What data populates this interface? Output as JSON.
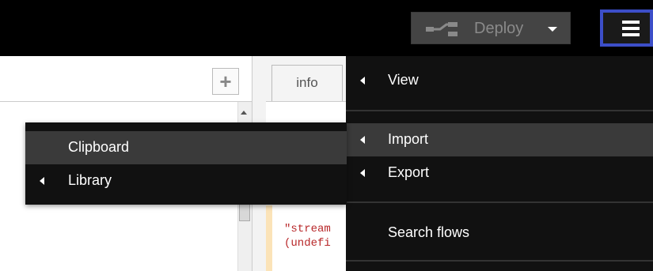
{
  "header": {
    "deploy_label": "Deploy",
    "menu_icon": "hamburger-icon",
    "accent_color": "#3c4ec8"
  },
  "workspace": {
    "add_tab_label": "+"
  },
  "sidebar": {
    "info_tab_label": "info",
    "debug_lines": [
      "\"stream",
      "(undefi"
    ]
  },
  "main_menu": {
    "items": [
      {
        "label": "View"
      },
      {
        "label": "Import"
      },
      {
        "label": "Export"
      },
      {
        "label": "Search flows"
      }
    ]
  },
  "import_submenu": {
    "items": [
      {
        "label": "Clipboard"
      },
      {
        "label": "Library"
      }
    ]
  }
}
